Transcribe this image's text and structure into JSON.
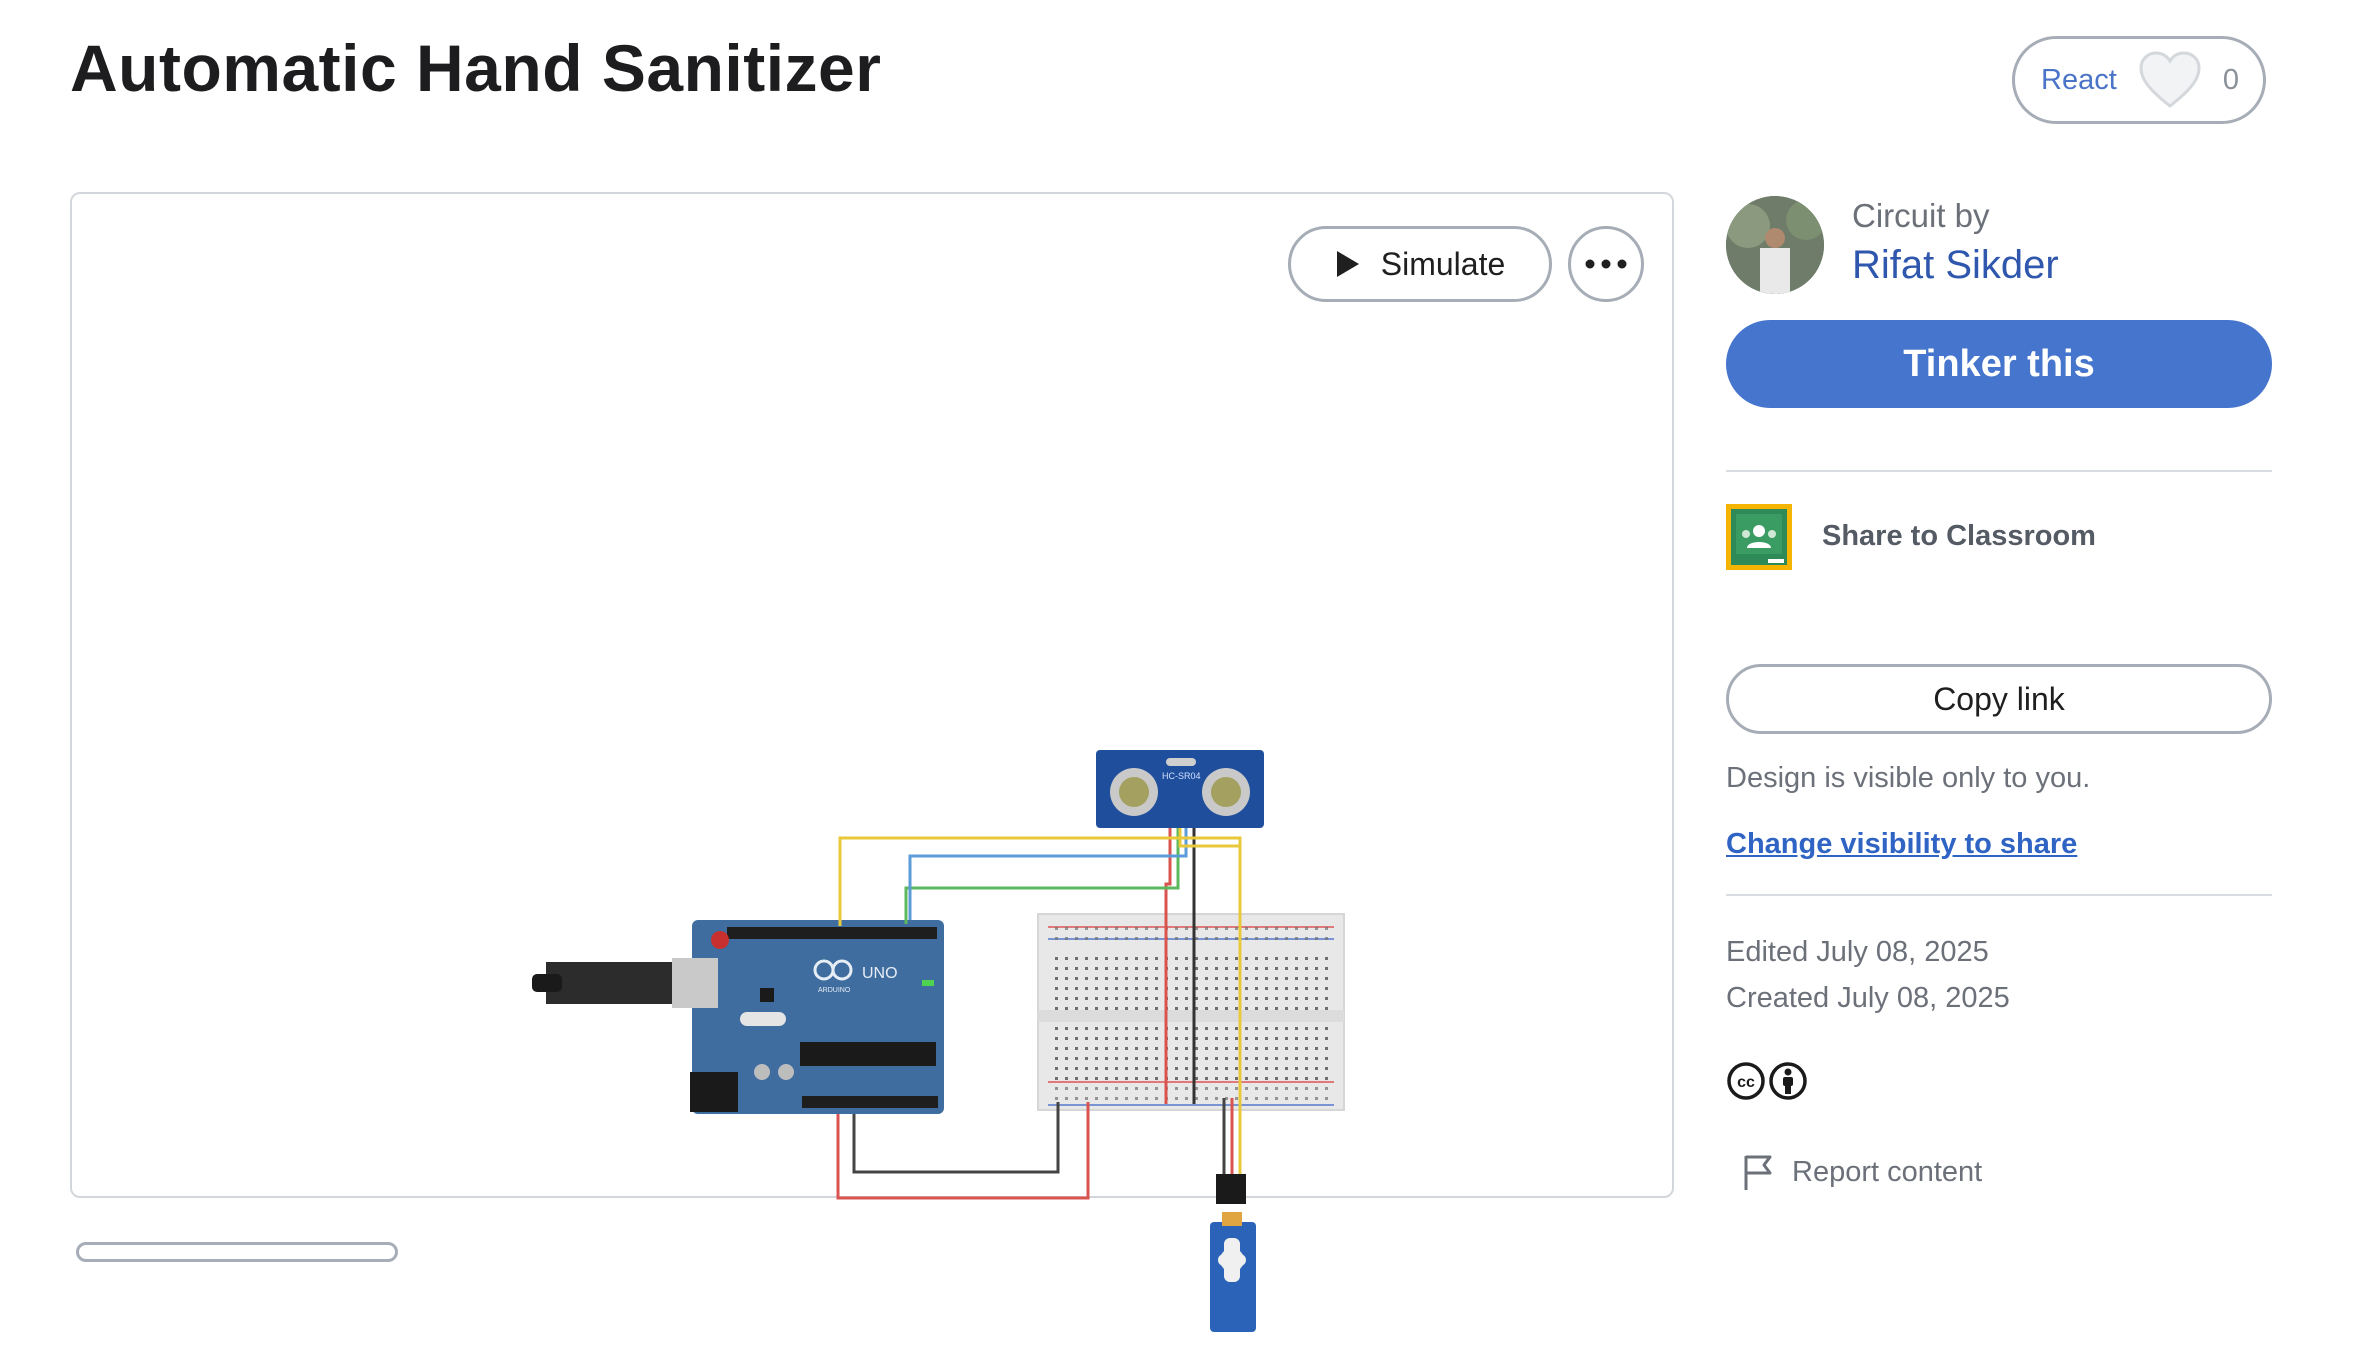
{
  "page": {
    "title": "Automatic Hand Sanitizer"
  },
  "react": {
    "label": "React",
    "count": "0"
  },
  "viewer": {
    "simulate_label": "Simulate",
    "components": {
      "sensor_label": "HC-SR04",
      "board_brand": "UNO",
      "board_sub": "ARDUINO"
    }
  },
  "sidebar": {
    "circuit_by": "Circuit by",
    "author": "Rifat Sikder",
    "tinker_label": "Tinker this",
    "share_classroom": "Share to Classroom",
    "copy_link": "Copy link",
    "visibility_note": "Design is visible only to you.",
    "change_visibility": "Change visibility to share",
    "edited": "Edited July 08, 2025",
    "created": "Created July 08, 2025",
    "report": "Report content"
  },
  "colors": {
    "accent": "#4675cd",
    "link": "#2f63c4",
    "author": "#2f57ad",
    "wire_yellow": "#e8c93a",
    "wire_blue": "#5a9bd8",
    "wire_green": "#5cb85c",
    "wire_red": "#d9534f",
    "wire_black": "#333333"
  }
}
